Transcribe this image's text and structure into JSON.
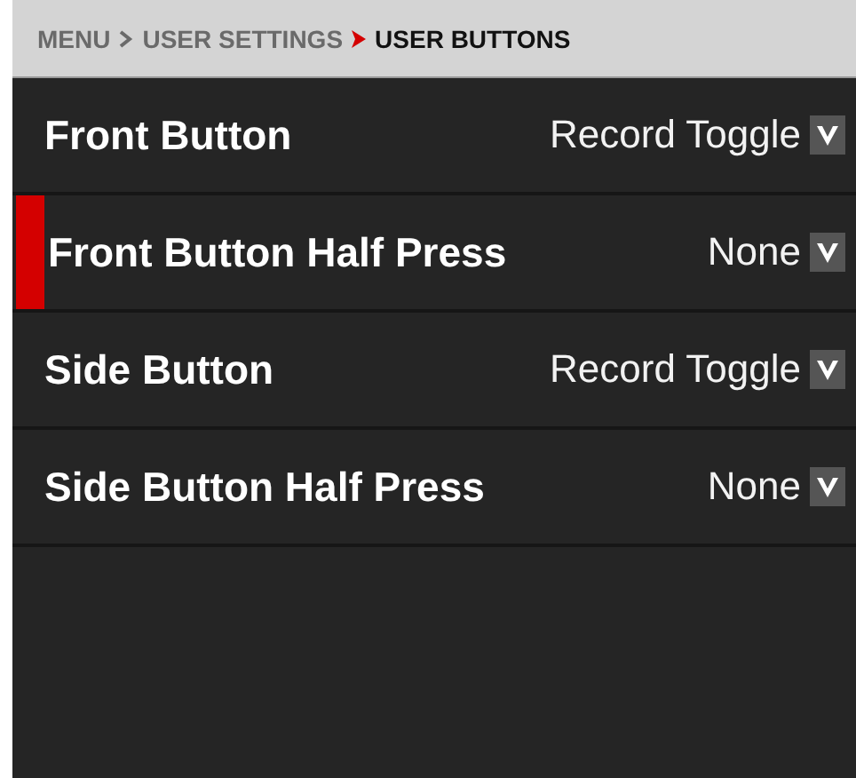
{
  "breadcrumb": [
    {
      "label": "MENU",
      "current": false
    },
    {
      "label": "USER SETTINGS",
      "current": false
    },
    {
      "label": "USER BUTTONS",
      "current": true
    }
  ],
  "settings": [
    {
      "label": "Front Button",
      "value": "Record Toggle",
      "selected": false
    },
    {
      "label": "Front Button Half Press",
      "value": "None",
      "selected": true
    },
    {
      "label": "Side Button",
      "value": "Record Toggle",
      "selected": false
    },
    {
      "label": "Side Button Half Press",
      "value": "None",
      "selected": false
    }
  ]
}
